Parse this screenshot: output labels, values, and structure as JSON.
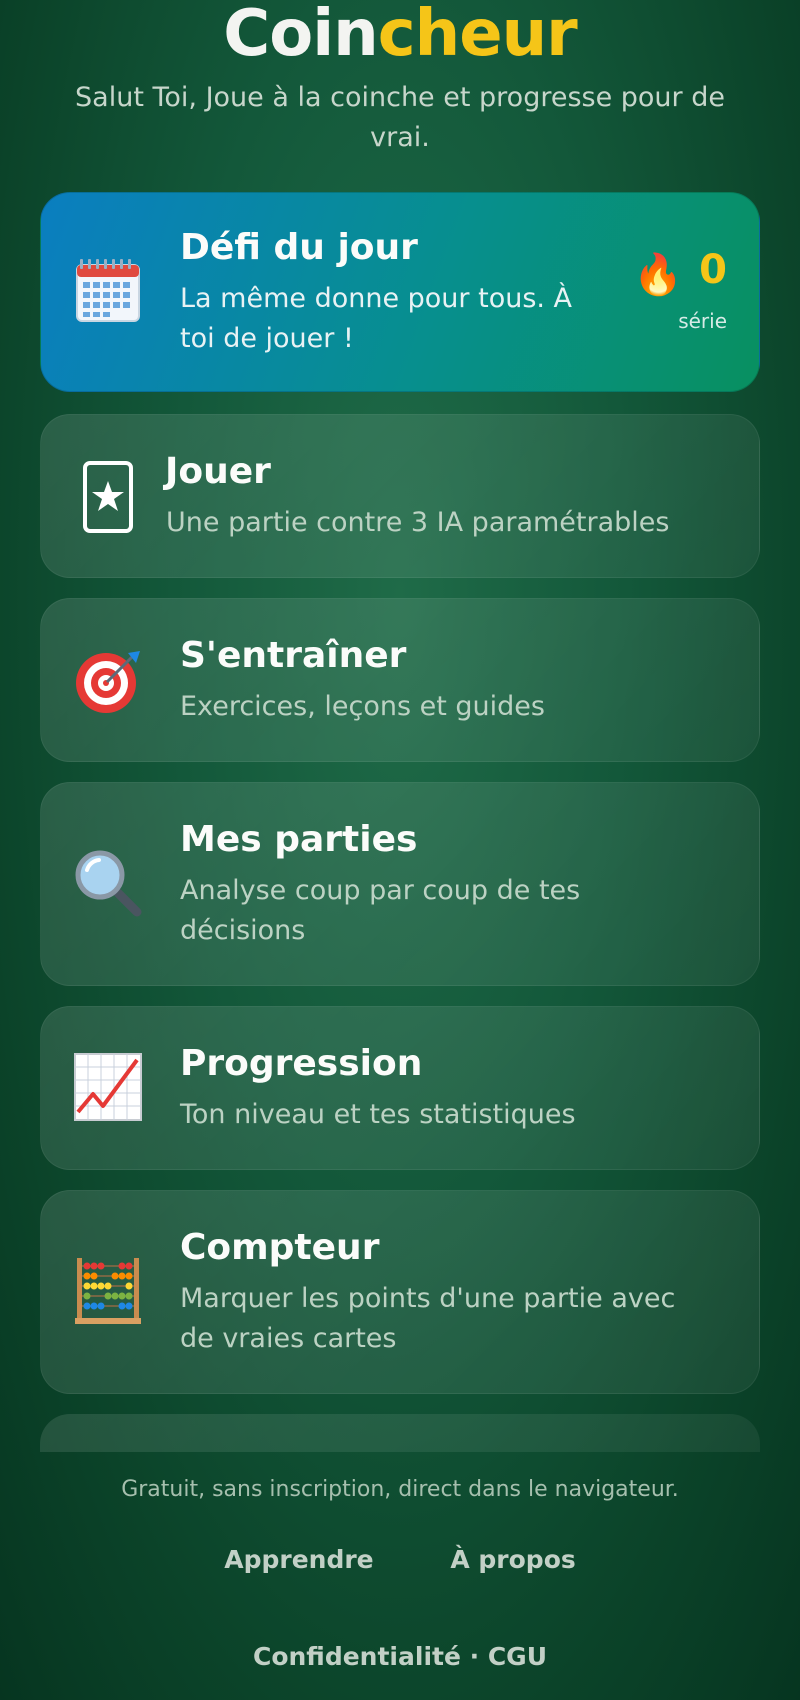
{
  "brand": {
    "part1": "Coin",
    "part2": "cheur"
  },
  "tagline": "Salut Toi, Joue à la coinche et progresse pour de vrai.",
  "daily": {
    "title": "Défi du jour",
    "desc": "La même donne pour tous. À toi de jouer !",
    "icon": "calendar-icon",
    "streak_icon": "🔥",
    "streak_count": "0",
    "streak_label": "série"
  },
  "menu": [
    {
      "title": "Jouer",
      "desc": "Une partie contre 3 IA paramétrables",
      "icon": "star-card-icon"
    },
    {
      "title": "S'entraîner",
      "desc": "Exercices, leçons et guides",
      "icon": "target-icon"
    },
    {
      "title": "Mes parties",
      "desc": "Analyse coup par coup de tes décisions",
      "icon": "magnifier-icon"
    },
    {
      "title": "Progression",
      "desc": "Ton niveau et tes statistiques",
      "icon": "chart-icon"
    },
    {
      "title": "Compteur",
      "desc": "Marquer les points d'une partie avec de vraies cartes",
      "icon": "abacus-icon"
    }
  ],
  "footer": {
    "note": "Gratuit, sans inscription, direct dans le navigateur.",
    "learn": "Apprendre",
    "about": "À propos",
    "legal": "Confidentialité · CGU"
  },
  "colors": {
    "accent": "#f5c518",
    "background": "#0f4d31"
  }
}
